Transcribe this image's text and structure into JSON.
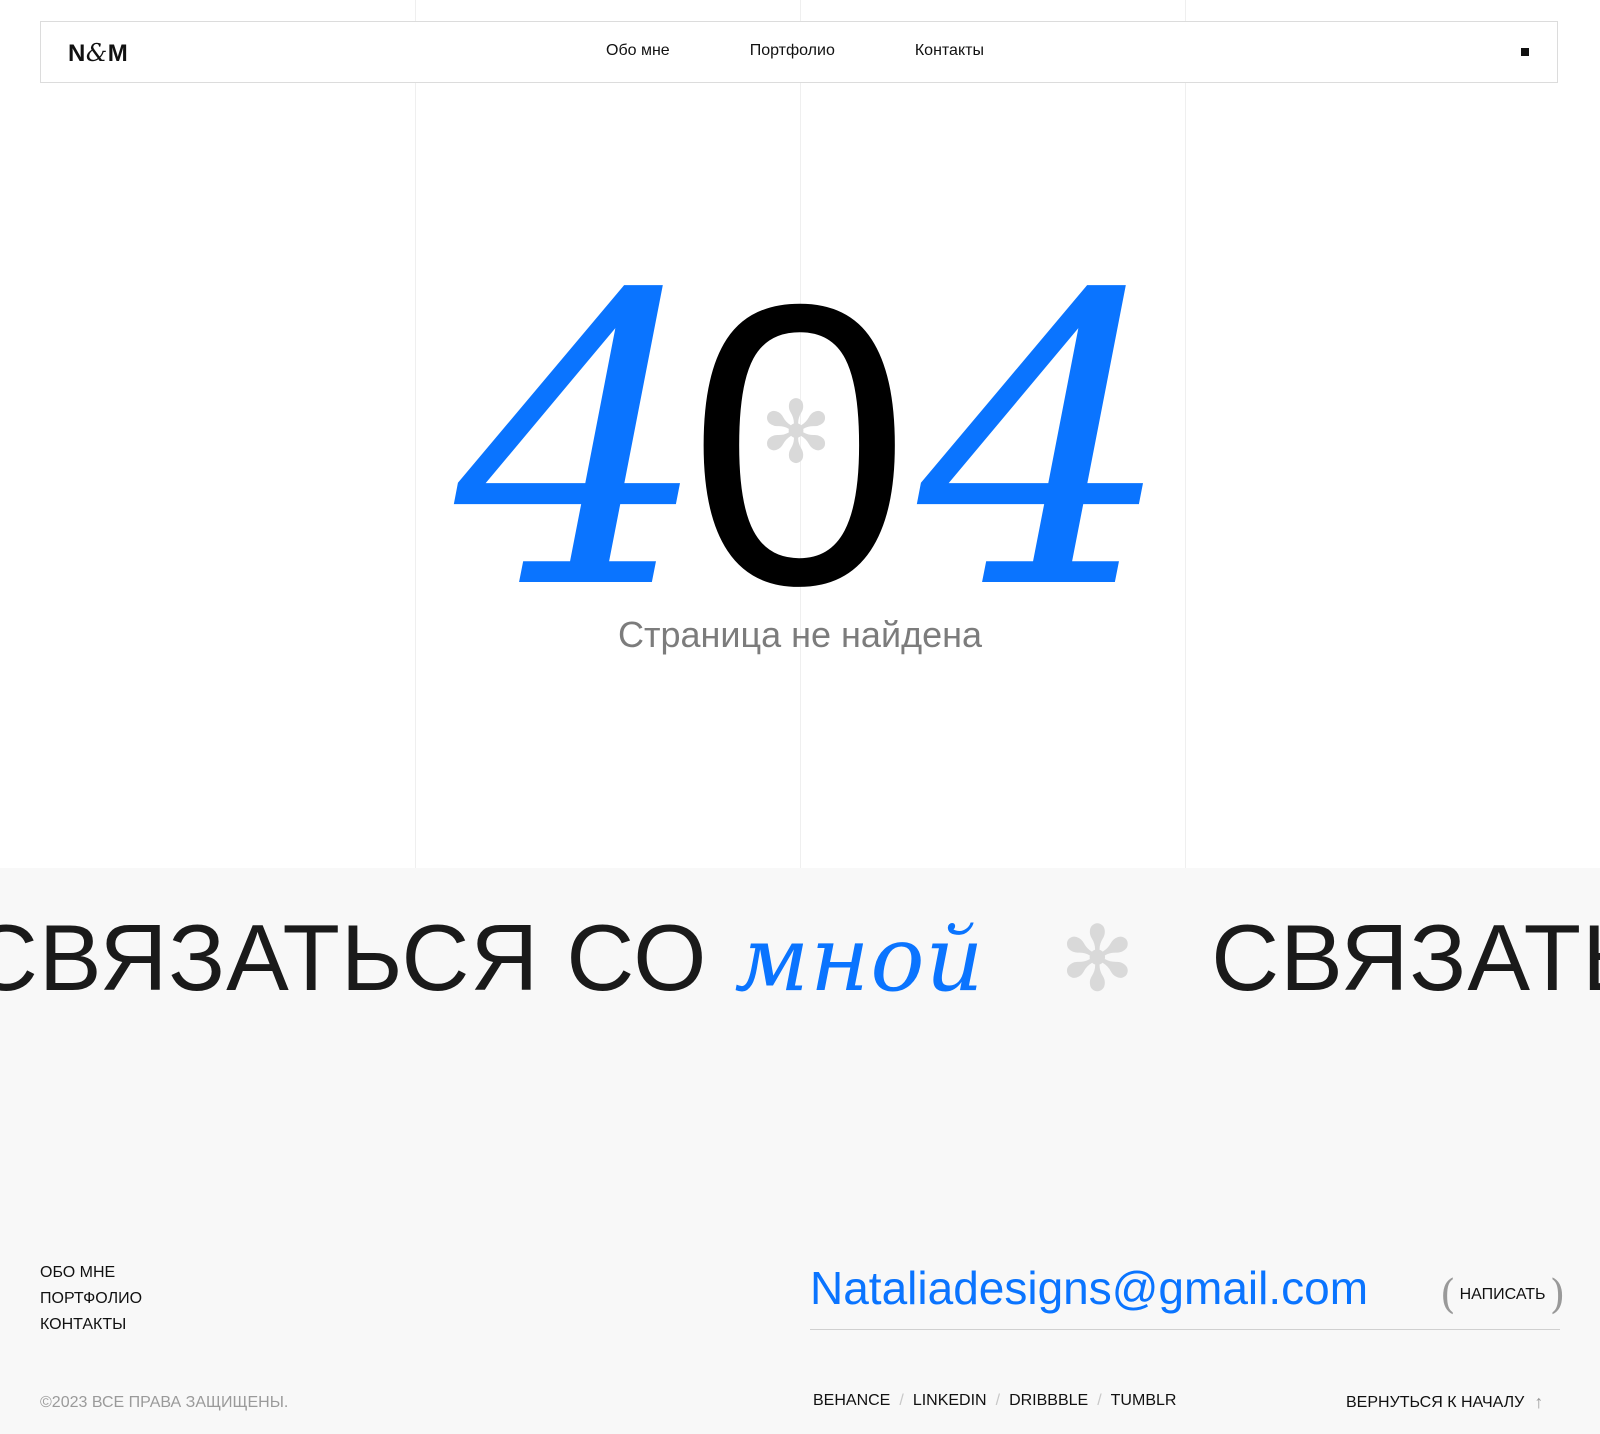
{
  "header": {
    "logo_n": "N",
    "logo_amp": "&",
    "logo_m": "M",
    "nav": [
      "Обо мне",
      "Портфолио",
      "Контакты"
    ]
  },
  "error": {
    "digit_left": "4",
    "digit_mid": "0",
    "digit_right": "4",
    "message": "Страница не найдена"
  },
  "marquee": {
    "text": "СВЯЗАТЬСЯ СО",
    "accent": "мной",
    "separator": "✻"
  },
  "footer": {
    "nav": [
      "ОБО МНЕ",
      "ПОРТФОЛИО",
      "КОНТАКТЫ"
    ],
    "email": "Nataliadesigns@gmail.com",
    "write_label": "НАПИСАТЬ",
    "copyright": "©2023 ВСЕ ПРАВА ЗАЩИЩЕНЫ.",
    "socials": [
      "BEHANCE",
      "LINKEDIN",
      "DRIBBBLE",
      "TUMBLR"
    ],
    "to_top": "ВЕРНУТЬСЯ К НАЧАЛУ"
  },
  "colors": {
    "accent": "#0a74ff",
    "text": "#111111",
    "muted": "#7c7c7c",
    "contact_bg": "#f8f8f8"
  }
}
